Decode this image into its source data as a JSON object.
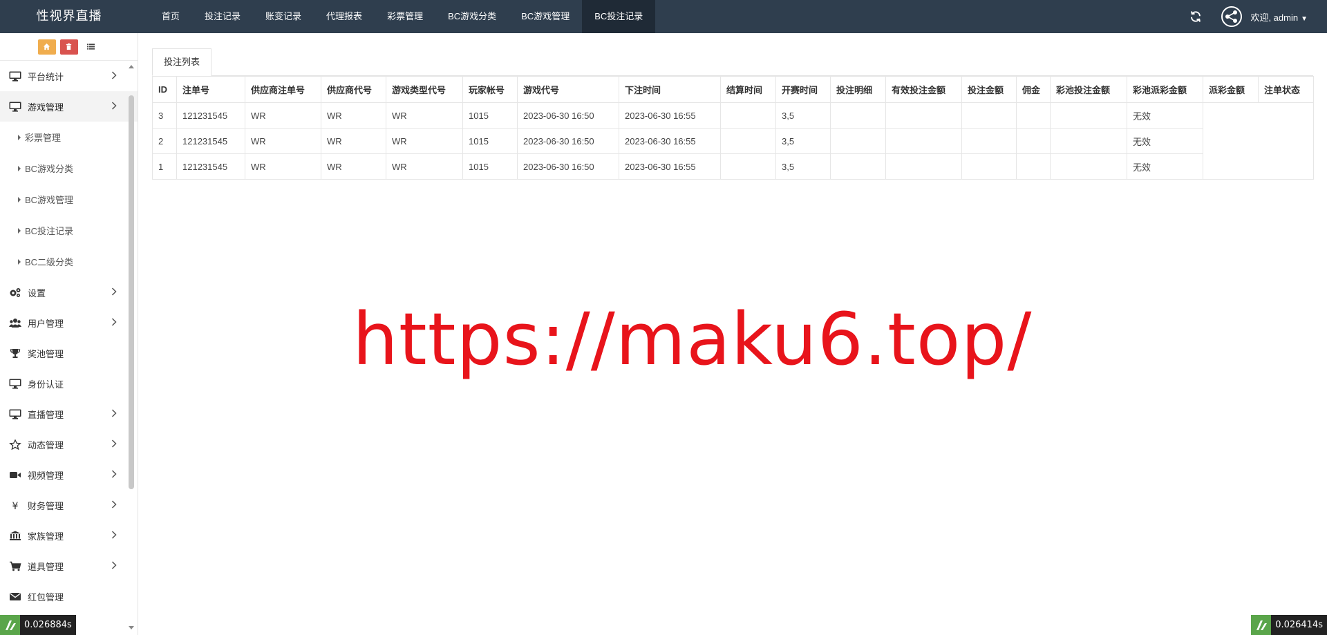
{
  "brand": "性视界直播",
  "topnav": [
    {
      "label": "首页",
      "active": false
    },
    {
      "label": "投注记录",
      "active": false
    },
    {
      "label": "账变记录",
      "active": false
    },
    {
      "label": "代理报表",
      "active": false
    },
    {
      "label": "彩票管理",
      "active": false
    },
    {
      "label": "BC游戏分类",
      "active": false
    },
    {
      "label": "BC游戏管理",
      "active": false
    },
    {
      "label": "BC投注记录",
      "active": true
    }
  ],
  "user": {
    "welcome": "欢迎, admin"
  },
  "sidebar": {
    "menu": [
      {
        "label": "平台统计",
        "icon": "monitor-icon",
        "chevron": true
      },
      {
        "label": "游戏管理",
        "icon": "monitor-icon",
        "chevron": true,
        "active": true,
        "children": [
          "彩票管理",
          "BC游戏分类",
          "BC游戏管理",
          "BC投注记录",
          "BC二级分类"
        ]
      },
      {
        "label": "设置",
        "icon": "gears-icon",
        "chevron": true
      },
      {
        "label": "用户管理",
        "icon": "users-icon",
        "chevron": true
      },
      {
        "label": "奖池管理",
        "icon": "trophy-icon",
        "chevron": false
      },
      {
        "label": "身份认证",
        "icon": "monitor-icon",
        "chevron": false
      },
      {
        "label": "直播管理",
        "icon": "monitor-icon",
        "chevron": true
      },
      {
        "label": "动态管理",
        "icon": "star-icon",
        "chevron": true
      },
      {
        "label": "视频管理",
        "icon": "video-camera-icon",
        "chevron": true
      },
      {
        "label": "财务管理",
        "icon": "yen-icon",
        "chevron": true
      },
      {
        "label": "家族管理",
        "icon": "bank-icon",
        "chevron": true
      },
      {
        "label": "道具管理",
        "icon": "cart-icon",
        "chevron": true
      },
      {
        "label": "红包管理",
        "icon": "envelope-icon",
        "chevron": false
      }
    ]
  },
  "main": {
    "tab": "投注列表",
    "table": {
      "headers": [
        "ID",
        "注单号",
        "供应商注单号",
        "供应商代号",
        "游戏类型代号",
        "玩家帐号",
        "游戏代号",
        "下注时间",
        "结算时间",
        "开赛时间",
        "投注明细",
        "有效投注金额",
        "投注金额",
        "佣金",
        "彩池投注金额",
        "彩池派彩金额",
        "派彩金额",
        "注单状态"
      ],
      "rows": [
        [
          "3",
          "121231545",
          "WR",
          "WR",
          "WR",
          "1015",
          "2023-06-30 16:50",
          "2023-06-30 16:55",
          "",
          "3,5",
          "",
          "",
          "",
          "",
          "",
          "无效"
        ],
        [
          "2",
          "121231545",
          "WR",
          "WR",
          "WR",
          "1015",
          "2023-06-30 16:50",
          "2023-06-30 16:55",
          "",
          "3,5",
          "",
          "",
          "",
          "",
          "",
          "无效"
        ],
        [
          "1",
          "121231545",
          "WR",
          "WR",
          "WR",
          "1015",
          "2023-06-30 16:50",
          "2023-06-30 16:55",
          "",
          "3,5",
          "",
          "",
          "",
          "",
          "",
          "无效"
        ]
      ]
    }
  },
  "watermark": "https://maku6.top/",
  "timers": {
    "left": "0.026884s",
    "right": "0.026414s"
  },
  "colors": {
    "navbar": "#2f3e4e",
    "active_nav": "#1f2a36",
    "watermark": "#e8141b",
    "home_btn": "#f0ad4e",
    "trash_btn": "#d9534f"
  }
}
